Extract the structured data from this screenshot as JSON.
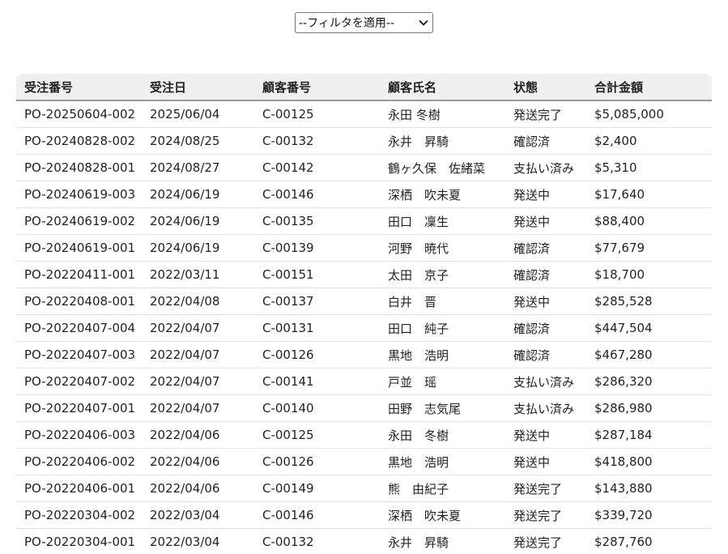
{
  "filter": {
    "selected": "--フィルタを適用--"
  },
  "table": {
    "headers": [
      "受注番号",
      "受注日",
      "顧客番号",
      "顧客氏名",
      "状態",
      "合計金額"
    ],
    "rows": [
      [
        "PO-20250604-002",
        "2025/06/04",
        "C-00125",
        "永田 冬樹",
        "発送完了",
        "$5,085,000"
      ],
      [
        "PO-20240828-002",
        "2024/08/25",
        "C-00132",
        "永井　昇騎",
        "確認済",
        "$2,400"
      ],
      [
        "PO-20240828-001",
        "2024/08/27",
        "C-00142",
        "鶴ヶ久保　佐緒菜",
        "支払い済み",
        "$5,310"
      ],
      [
        "PO-20240619-003",
        "2024/06/19",
        "C-00146",
        "深栖　吹未夏",
        "発送中",
        "$17,640"
      ],
      [
        "PO-20240619-002",
        "2024/06/19",
        "C-00135",
        "田口　凜生",
        "発送中",
        "$88,400"
      ],
      [
        "PO-20240619-001",
        "2024/06/19",
        "C-00139",
        "河野　暁代",
        "確認済",
        "$77,679"
      ],
      [
        "PO-20220411-001",
        "2022/03/11",
        "C-00151",
        "太田　京子",
        "確認済",
        "$18,700"
      ],
      [
        "PO-20220408-001",
        "2022/04/08",
        "C-00137",
        "白井　晋",
        "発送中",
        "$285,528"
      ],
      [
        "PO-20220407-004",
        "2022/04/07",
        "C-00131",
        "田口　純子",
        "確認済",
        "$447,504"
      ],
      [
        "PO-20220407-003",
        "2022/04/07",
        "C-00126",
        "黒地　浩明",
        "確認済",
        "$467,280"
      ],
      [
        "PO-20220407-002",
        "2022/04/07",
        "C-00141",
        "戸並　瑶",
        "支払い済み",
        "$286,320"
      ],
      [
        "PO-20220407-001",
        "2022/04/07",
        "C-00140",
        "田野　志気尾",
        "支払い済み",
        "$286,980"
      ],
      [
        "PO-20220406-003",
        "2022/04/06",
        "C-00125",
        "永田　冬樹",
        "発送中",
        "$287,184"
      ],
      [
        "PO-20220406-002",
        "2022/04/06",
        "C-00126",
        "黒地　浩明",
        "発送中",
        "$418,800"
      ],
      [
        "PO-20220406-001",
        "2022/04/06",
        "C-00149",
        "熊　由紀子",
        "発送完了",
        "$143,880"
      ],
      [
        "PO-20220304-002",
        "2022/03/04",
        "C-00146",
        "深栖　吹未夏",
        "発送完了",
        "$339,720"
      ],
      [
        "PO-20220304-001",
        "2022/03/04",
        "C-00132",
        "永井　昇騎",
        "発送完了",
        "$287,760"
      ]
    ]
  }
}
